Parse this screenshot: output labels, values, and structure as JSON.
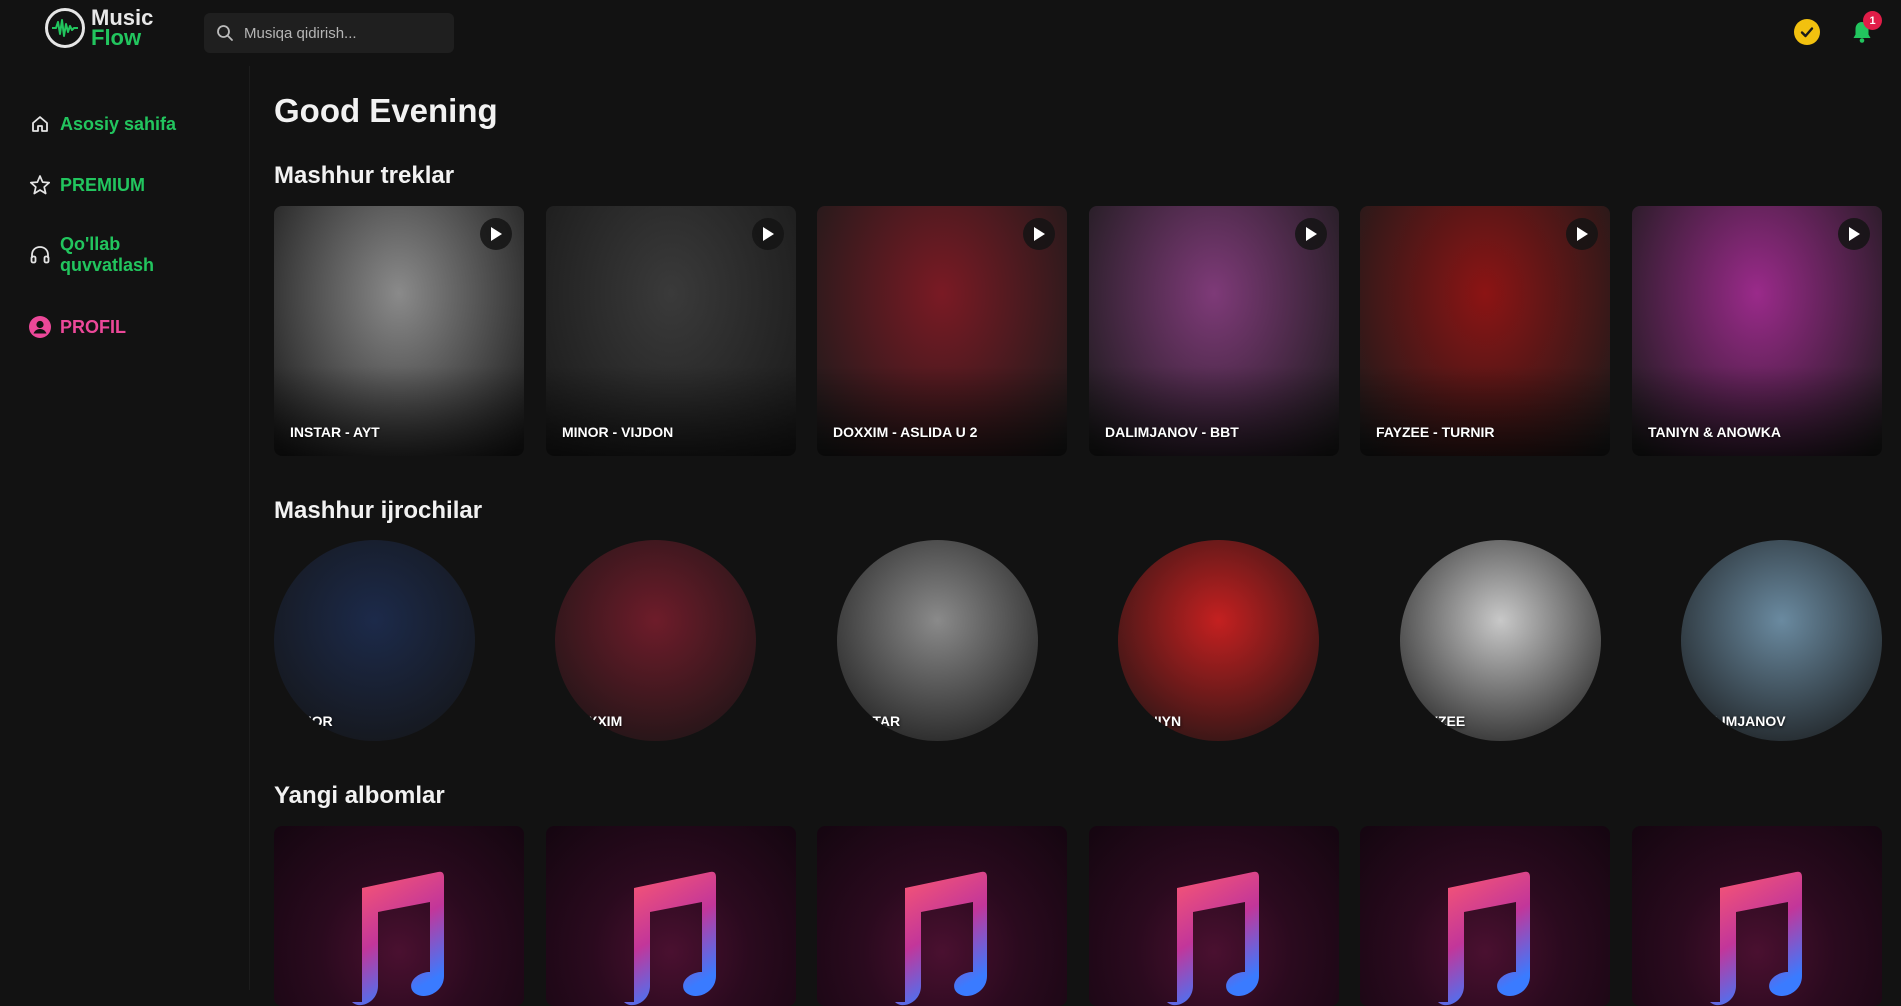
{
  "app": {
    "logo_line1": "Music",
    "logo_line2": "Flow",
    "accent": "#22c55e",
    "pink": "#ec4899"
  },
  "search": {
    "placeholder": "Musiqa qidirish..."
  },
  "header": {
    "notification_count": "1",
    "verified_color": "#f2c10f"
  },
  "sidebar": {
    "items": [
      {
        "label": "Asosiy sahifa",
        "icon": "home-icon"
      },
      {
        "label": "PREMIUM",
        "icon": "star-icon"
      },
      {
        "label": "Qo'llab quvvatlash",
        "icon": "headphones-icon"
      },
      {
        "label": "PROFIL",
        "icon": "user-circle-icon"
      }
    ]
  },
  "main": {
    "greeting": "Good Evening",
    "sections": {
      "tracks": "Mashhur treklar",
      "artists": "Mashhur ijrochilar",
      "albums": "Yangi albomlar"
    },
    "tracks": [
      {
        "label": "INSTAR - AYT",
        "color": "#8a8a8a"
      },
      {
        "label": "MINOR - VIJDON",
        "color": "#3a3a3a"
      },
      {
        "label": "DOXXIM - ASLIDA U 2",
        "color": "#7a1a24"
      },
      {
        "label": "DALIMJANOV - BBT",
        "color": "#7e3a78"
      },
      {
        "label": "FAYZEE - TURNIR",
        "color": "#8c1414"
      },
      {
        "label": "TANIYN & ANOWKA",
        "color": "#9a2a8a"
      }
    ],
    "artists": [
      {
        "label": "MINOR",
        "color": "#1c2a4a"
      },
      {
        "label": "DOXXIM",
        "color": "#6e1c2a"
      },
      {
        "label": "INSTAR",
        "color": "#8a8a8a"
      },
      {
        "label": "TANIYN",
        "color": "#c42020"
      },
      {
        "label": "FAYZEE",
        "color": "#c8c8c8"
      },
      {
        "label": "DALIMJANOV",
        "color": "#6a8aa0"
      }
    ],
    "albums": [
      {
        "icon": "music-note-icon"
      },
      {
        "icon": "music-note-icon"
      },
      {
        "icon": "music-note-icon"
      },
      {
        "icon": "music-note-icon"
      },
      {
        "icon": "music-note-icon"
      },
      {
        "icon": "music-note-icon"
      }
    ]
  }
}
